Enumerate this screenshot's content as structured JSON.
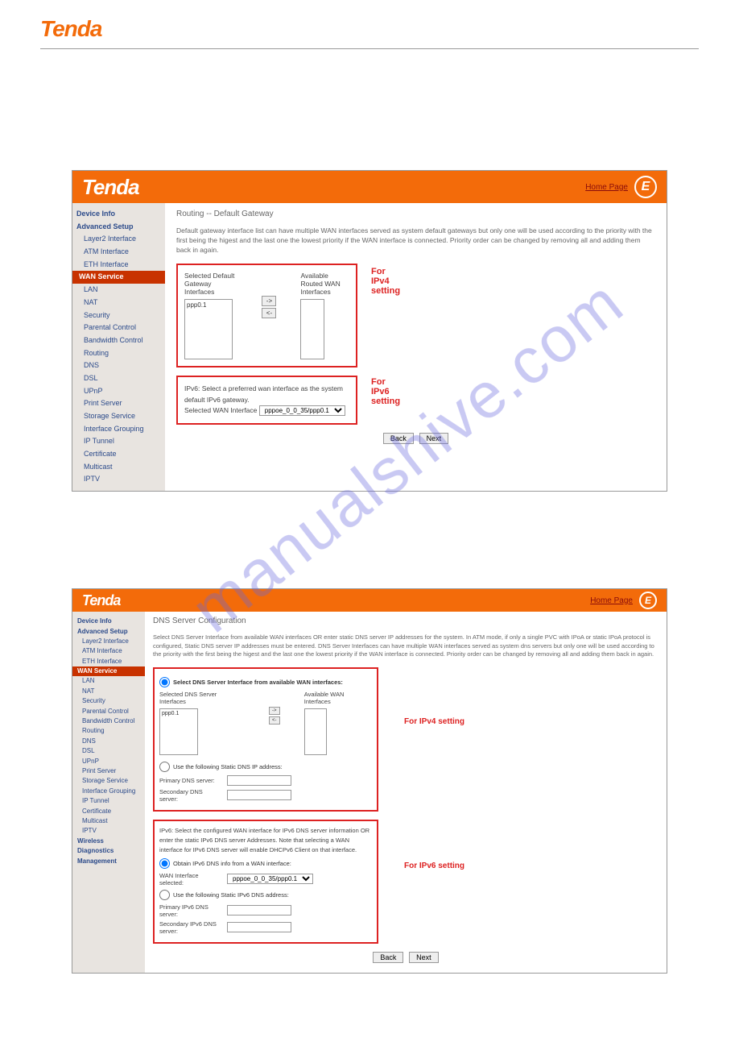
{
  "page_logo": "Tenda",
  "watermark": "manualshive.com",
  "s1": {
    "header_logo": "Tenda",
    "header_link": "Home Page",
    "header_icon": "E",
    "sidebar_heading_device": "Device Info",
    "sidebar_heading_adv": "Advanced Setup",
    "sidebar_items": {
      "layer2": "Layer2 Interface",
      "atm": "ATM Interface",
      "eth": "ETH Interface",
      "wan": "WAN Service",
      "lan": "LAN",
      "nat": "NAT",
      "security": "Security",
      "parental": "Parental Control",
      "bandwidth": "Bandwidth Control",
      "routing": "Routing",
      "dns": "DNS",
      "dsl": "DSL",
      "upnp": "UPnP",
      "print": "Print Server",
      "storage": "Storage Service",
      "ifgroup": "Interface Grouping",
      "iptunnel": "IP Tunnel",
      "cert": "Certificate",
      "multicast": "Multicast",
      "iptv": "IPTV"
    },
    "crumb": "Routing -- Default Gateway",
    "desc": "Default gateway interface list can have multiple WAN interfaces served as system default gateways but only one will be used according to the priority with the first being the higest and the last one the lowest priority if the WAN interface is connected. Priority order can be changed by removing all and adding them back in again.",
    "ipv4_col1": "Selected Default Gateway Interfaces",
    "ipv4_col2": "Available Routed WAN Interfaces",
    "ipv4_list_value": "ppp0.1",
    "move_right": "->",
    "move_left": "<-",
    "ipv4_label": "For IPv4 setting",
    "ipv6_label": "For IPv6 setting",
    "ipv6_note": "IPv6: Select a preferred wan interface as the system default IPv6 gateway.",
    "ipv6_sel_label": "Selected WAN Interface",
    "ipv6_sel_value": "pppoe_0_0_35/ppp0.1",
    "btn_back": "Back",
    "btn_next": "Next"
  },
  "s2": {
    "header_logo": "Tenda",
    "header_link": "Home Page",
    "header_icon": "E",
    "sidebar_heading_device": "Device Info",
    "sidebar_heading_adv": "Advanced Setup",
    "sidebar_items": {
      "layer2": "Layer2 Interface",
      "atm": "ATM Interface",
      "eth": "ETH Interface",
      "wan": "WAN Service",
      "lan": "LAN",
      "nat": "NAT",
      "security": "Security",
      "parental": "Parental Control",
      "bandwidth": "Bandwidth Control",
      "routing": "Routing",
      "dns": "DNS",
      "dsl": "DSL",
      "upnp": "UPnP",
      "print": "Print Server",
      "storage": "Storage Service",
      "ifgroup": "Interface Grouping",
      "iptunnel": "IP Tunnel",
      "cert": "Certificate",
      "multicast": "Multicast",
      "iptv": "IPTV",
      "wireless": "Wireless",
      "diag": "Diagnostics",
      "mgmt": "Management"
    },
    "crumb": "DNS Server Configuration",
    "desc": "Select DNS Server Interface from available WAN interfaces OR enter static DNS server IP addresses for the system. In ATM mode, if only a single PVC with IPoA or static IPoA protocol is configured, Static DNS server IP addresses must be entered. DNS Server Interfaces can have multiple WAN interfaces served as system dns servers but only one will be used according to the priority with the first being the higest and the last one the lowest priority if the WAN interface is connected. Priority order can be changed by removing all and adding them back in again.",
    "radio_select_if": "Select DNS Server Interface from available WAN interfaces:",
    "ipv4_col1": "Selected DNS Server Interfaces",
    "ipv4_col2": "Available WAN Interfaces",
    "ipv4_list_value": "ppp0.1",
    "move_right": "->",
    "move_left": "<-",
    "radio_static": "Use the following Static DNS IP address:",
    "primary_label": "Primary DNS server:",
    "secondary_label": "Secondary DNS server:",
    "ipv4_label": "For IPv4 setting",
    "ipv6_label": "For IPv6 setting",
    "ipv6_note": "IPv6: Select the configured WAN interface for IPv6 DNS server information OR enter the static IPv6 DNS server Addresses. Note that selecting a WAN interface for IPv6 DNS server will enable DHCPv6 Client on that interface.",
    "radio_obtain": "Obtain IPv6 DNS info from a WAN interface:",
    "wan_if_label": "WAN Interface selected:",
    "wan_if_value": "pppoe_0_0_35/ppp0.1",
    "radio_static6": "Use the following Static IPv6 DNS address:",
    "primary6_label": "Primary IPv6 DNS server:",
    "secondary6_label": "Secondary IPv6 DNS server:",
    "btn_back": "Back",
    "btn_next": "Next"
  }
}
